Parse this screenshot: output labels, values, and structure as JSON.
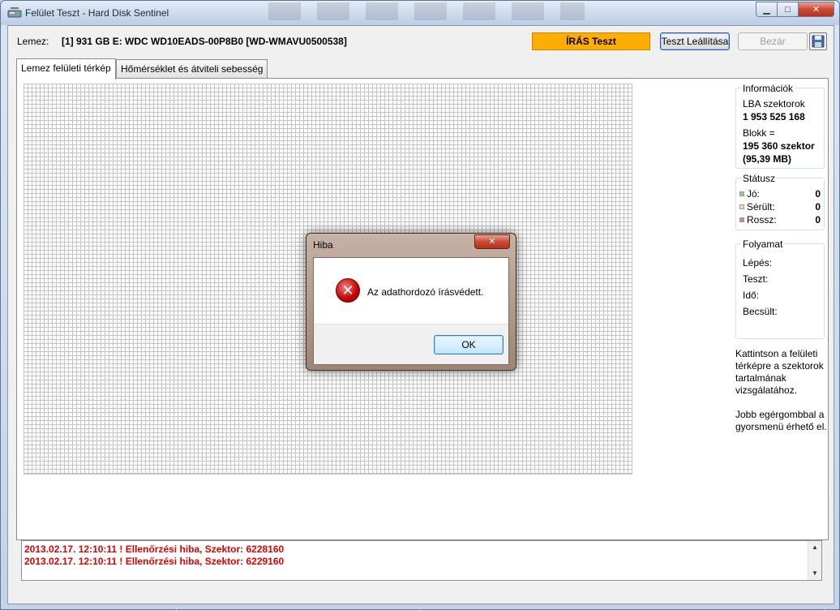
{
  "window": {
    "title": "Felület Teszt - Hard Disk Sentinel",
    "minimize_glyph": "▁",
    "maximize_glyph": "□",
    "close_glyph": "✕"
  },
  "toolbar": {
    "drive_label": "Lemez:",
    "drive_value": "[1] 931 GB E: WDC WD10EADS-00P8B0 [WD-WMAVU0500538]",
    "mode_badge": "ÍRÁS Teszt",
    "stop_button": "Teszt Leállítása",
    "close_button": "Bezár",
    "save_icon": "floppy-disk-icon",
    "mode_color": "#ffad00"
  },
  "tabs": [
    {
      "label": "Lemez felületi térkép",
      "active": true
    },
    {
      "label": "Hőmérséklet és átviteli sebesség",
      "active": false
    }
  ],
  "sidebar": {
    "info": {
      "title": "Információk",
      "lba_label": "LBA szektorok",
      "lba_value": "1 953 525 168",
      "block_label": "Blokk =",
      "block_value": "195 360 szektor",
      "block_size": "(95,39 MB)"
    },
    "status": {
      "title": "Státusz",
      "rows": [
        {
          "label": "Jó:",
          "value": "0",
          "color": "#8fd08f"
        },
        {
          "label": "Sérült:",
          "value": "0",
          "color": "#e8e890"
        },
        {
          "label": "Rossz:",
          "value": "0",
          "color": "#e08080"
        }
      ]
    },
    "progress": {
      "title": "Folyamat",
      "step": "Lépés:",
      "test": "Teszt:",
      "time": "Idő:",
      "estimated": "Becsült:"
    },
    "hint1": "Kattintson a felületi térképre a szektorok tartalmának vizsgálatához.",
    "hint2": "Jobb egérgombbal a gyorsmenü érhető el."
  },
  "log": {
    "lines": [
      "2013.02.17.  12:10:11 ! Ellenőrzési hiba, Szektor: 6228160",
      "2013.02.17.  12:10:11 ! Ellenőrzési hiba, Szektor: 6229160"
    ],
    "log_color": "#e00000"
  },
  "dialog": {
    "title": "Hiba",
    "message": "Az adathordozó írásvédett.",
    "ok_label": "OK",
    "close_glyph": "✕",
    "icon": "error-icon"
  }
}
